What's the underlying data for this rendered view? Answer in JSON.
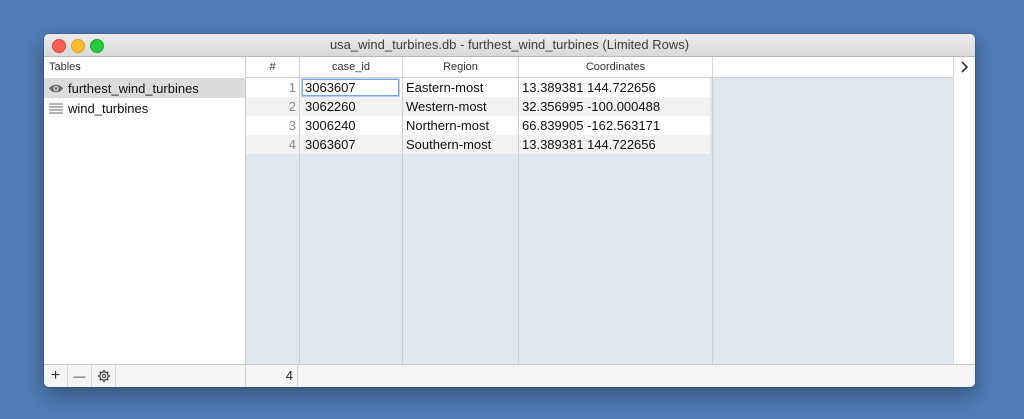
{
  "window": {
    "title": "usa_wind_turbines.db - furthest_wind_turbines (Limited Rows)"
  },
  "sidebar": {
    "header": "Tables",
    "items": [
      {
        "label": "furthest_wind_turbines",
        "icon": "eye-icon",
        "selected": true
      },
      {
        "label": "wind_turbines",
        "icon": "table-lines-icon",
        "selected": false
      }
    ]
  },
  "grid": {
    "columns": [
      "#",
      "case_id",
      "Region",
      "Coordinates"
    ],
    "rows": [
      {
        "num": "1",
        "case_id": "3063607",
        "region": "Eastern-most",
        "coordinates": "13.389381 144.722656"
      },
      {
        "num": "2",
        "case_id": "3062260",
        "region": "Western-most",
        "coordinates": "32.356995 -100.000488"
      },
      {
        "num": "3",
        "case_id": "3006240",
        "region": "Northern-most",
        "coordinates": "66.839905 -162.563171"
      },
      {
        "num": "4",
        "case_id": "3063607",
        "region": "Southern-most",
        "coordinates": "13.389381 144.722656"
      }
    ]
  },
  "footer": {
    "add_label": "+",
    "remove_label": "—",
    "settings_icon": "gear-icon",
    "row_count": "4"
  },
  "colors": {
    "desktop": "#4f7db6",
    "grid_empty": "#dfe6ee",
    "selected_item": "#dcdcdc"
  }
}
